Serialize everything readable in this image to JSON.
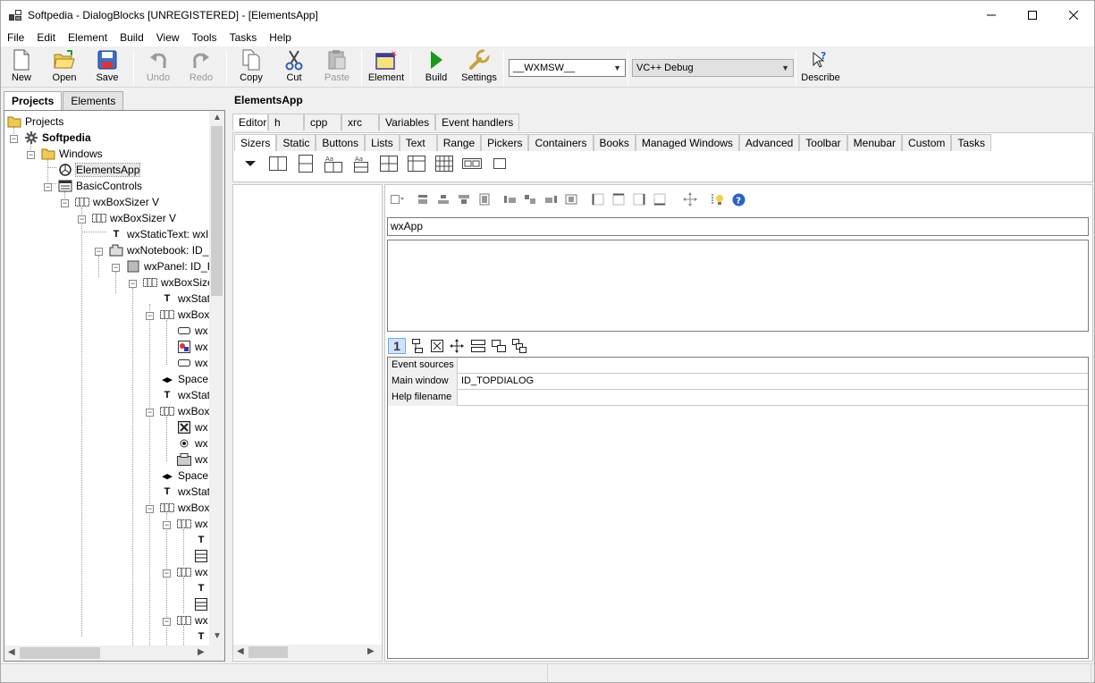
{
  "window": {
    "title": "Softpedia - DialogBlocks [UNREGISTERED] - [ElementsApp]",
    "controls": [
      "minimize",
      "maximize",
      "close"
    ]
  },
  "menu": [
    "File",
    "Edit",
    "Element",
    "Build",
    "View",
    "Tools",
    "Tasks",
    "Help"
  ],
  "toolbar": {
    "new": "New",
    "open": "Open",
    "save": "Save",
    "undo": "Undo",
    "redo": "Redo",
    "copy": "Copy",
    "cut": "Cut",
    "paste": "Paste",
    "element": "Element",
    "build": "Build",
    "settings": "Settings",
    "platform": "__WXMSW__",
    "config": "VC++ Debug",
    "describe": "Describe"
  },
  "left_tabs": [
    "Projects",
    "Elements"
  ],
  "tree": [
    {
      "label": "Projects",
      "icon": "folder-icon"
    },
    {
      "label": "Softpedia",
      "icon": "gear-icon"
    },
    {
      "label": "Windows",
      "icon": "folder-icon"
    },
    {
      "label": "ElementsApp",
      "icon": "app-icon"
    },
    {
      "label": "BasicControls",
      "icon": "dialog-icon"
    },
    {
      "label": "wxBoxSizer V",
      "icon": "sizer-icon"
    },
    {
      "label": "wxBoxSizer V",
      "icon": "sizer-icon"
    },
    {
      "label": "wxStaticText: wxI",
      "icon": "text-icon"
    },
    {
      "label": "wxNotebook: ID_",
      "icon": "notebook-icon"
    },
    {
      "label": "wxPanel: ID_E",
      "icon": "panel-icon"
    },
    {
      "label": "wxBoxSize",
      "icon": "sizer-icon"
    },
    {
      "label": "wxStat",
      "icon": "text-icon"
    },
    {
      "label": "wxBox",
      "icon": "sizer-icon"
    },
    {
      "label": "wx",
      "icon": "textctrl-icon"
    },
    {
      "label": "wx",
      "icon": "bitmap-icon"
    },
    {
      "label": "wx",
      "icon": "textctrl-icon"
    },
    {
      "label": "Space",
      "icon": "spacer-icon"
    },
    {
      "label": "wxStat",
      "icon": "text-icon"
    },
    {
      "label": "wxBox",
      "icon": "sizer-icon"
    },
    {
      "label": "wx",
      "icon": "checkbox-icon"
    },
    {
      "label": "wx",
      "icon": "radio-icon"
    },
    {
      "label": "wx",
      "icon": "choice-icon"
    },
    {
      "label": "Space",
      "icon": "spacer-icon"
    },
    {
      "label": "wxStat",
      "icon": "text-icon"
    },
    {
      "label": "wxBox",
      "icon": "sizer-icon"
    },
    {
      "label": "wx",
      "icon": "sizer-icon"
    },
    {
      "label": "T",
      "icon": "text-icon"
    },
    {
      "label": "",
      "icon": "list-icon"
    },
    {
      "label": "wx",
      "icon": "sizer-icon"
    },
    {
      "label": "T",
      "icon": "text-icon"
    },
    {
      "label": "",
      "icon": "list-icon"
    },
    {
      "label": "wx",
      "icon": "sizer-icon"
    },
    {
      "label": "T",
      "icon": "text-icon"
    }
  ],
  "right": {
    "heading": "ElementsApp",
    "editor_tabs": [
      "Editor",
      "h",
      "cpp",
      "xrc",
      "Variables",
      "Event handlers"
    ],
    "palette_tabs": [
      "Sizers",
      "Static",
      "Buttons",
      "Lists",
      "Text",
      "Range",
      "Pickers",
      "Containers",
      "Books",
      "Managed Windows",
      "Advanced",
      "Toolbar",
      "Menubar",
      "Custom",
      "Tasks"
    ],
    "app_name": "wxApp",
    "properties": [
      {
        "key": "Event sources",
        "value": ""
      },
      {
        "key": "Main window",
        "value": "ID_TOPDIALOG"
      },
      {
        "key": "Help filename",
        "value": ""
      }
    ],
    "prop_toolbar_first": "1"
  },
  "colors": {
    "accent_blue": "#2a63c8",
    "build_green": "#1a9a1a",
    "folder_yellow": "#f2c94c"
  }
}
